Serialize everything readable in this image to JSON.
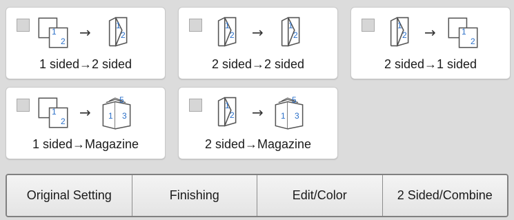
{
  "options": [
    {
      "label": "1 sided→2 sided",
      "checked": false
    },
    {
      "label": "2 sided→2 sided",
      "checked": false
    },
    {
      "label": "2 sided→1 sided",
      "checked": false
    },
    {
      "label": "1 sided→Magazine",
      "checked": false
    },
    {
      "label": "2 sided→Magazine",
      "checked": false
    }
  ],
  "glyphs": {
    "arrow": "→",
    "page_one": "1",
    "page_two": "2",
    "page_three": "3",
    "page_five": "5"
  },
  "tabs": [
    {
      "label": "Original Setting"
    },
    {
      "label": "Finishing"
    },
    {
      "label": "Edit/Color"
    },
    {
      "label": "2 Sided/Combine"
    }
  ],
  "colors": {
    "background": "#dcdcdc",
    "card": "#ffffff",
    "page_number": "#2a6fc8",
    "page_outline": "#555555",
    "checkbox_fill": "#d6d6d6",
    "tab_border": "#808080"
  },
  "icons": {
    "one_sided": "one-sided-doc-icon",
    "two_sided": "two-sided-doc-icon",
    "magazine": "magazine-booklet-icon",
    "arrow": "arrow-right-icon"
  }
}
